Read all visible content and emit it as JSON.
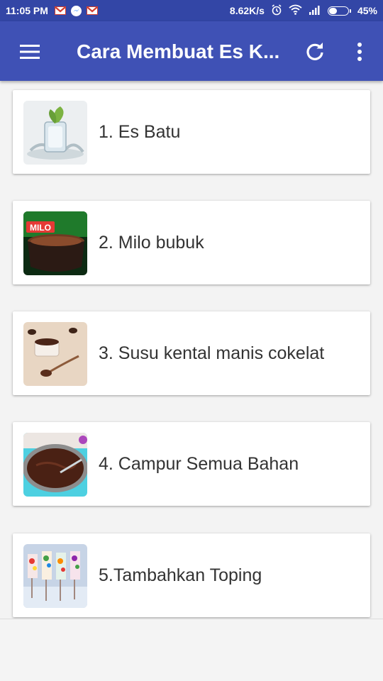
{
  "status_bar": {
    "time": "11:05 PM",
    "speed": "8.62K/s",
    "battery_percent": "45%",
    "battery_level": 0.45,
    "icons": [
      "gmail-icon",
      "messenger-icon",
      "gmail-icon",
      "alarm-icon",
      "wifi-icon",
      "signal-icon",
      "battery-icon"
    ]
  },
  "app_bar": {
    "title": "Cara Membuat Es K...",
    "icons": [
      "menu-icon",
      "refresh-icon",
      "more-vert-icon"
    ],
    "color": "#3f51b5",
    "status_color": "#3346a6"
  },
  "list": {
    "items": [
      {
        "label": "1. Es Batu",
        "image": "ice-cube-photo"
      },
      {
        "label": "2. Milo bubuk",
        "image": "milo-powder-photo"
      },
      {
        "label": "3. Susu kental manis cokelat",
        "image": "chocolate-condensed-milk-photo"
      },
      {
        "label": "4. Campur Semua Bahan",
        "image": "mixed-ingredients-photo"
      },
      {
        "label": "5.Tambahkan Toping",
        "image": "toppings-photo"
      }
    ]
  }
}
